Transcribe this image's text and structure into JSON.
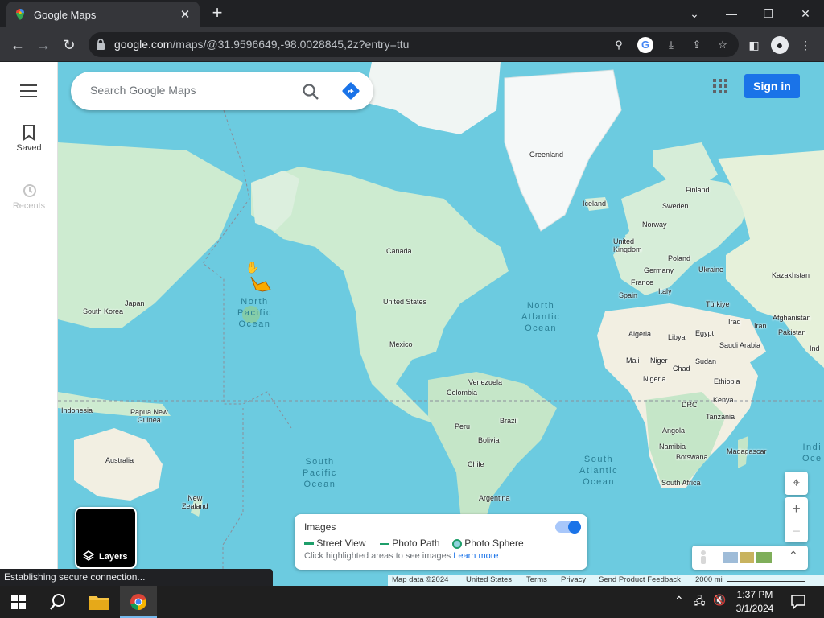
{
  "browser": {
    "tab_title": "Google Maps",
    "url_host": "google.com",
    "url_path": "/maps/@31.9596649,-98.0028845,2z?entry=ttu"
  },
  "rail": {
    "saved_label": "Saved",
    "recents_label": "Recents"
  },
  "search": {
    "placeholder": "Search Google Maps"
  },
  "header": {
    "signin_label": "Sign in"
  },
  "map_labels": {
    "greenland": "Greenland",
    "iceland": "Iceland",
    "finland": "Finland",
    "sweden": "Sweden",
    "norway": "Norway",
    "united_kingdom": "United\nKingdom",
    "poland": "Poland",
    "ukraine": "Ukraine",
    "germany": "Germany",
    "france": "France",
    "italy": "Italy",
    "spain": "Spain",
    "turkiye": "Türkiye",
    "kazakhstan": "Kazakhstan",
    "iraq": "Iraq",
    "iran": "Iran",
    "afghanistan": "Afghanistan",
    "pakistan": "Pakistan",
    "india": "Ind",
    "algeria": "Algeria",
    "libya": "Libya",
    "egypt": "Egypt",
    "saudi_arabia": "Saudi Arabia",
    "mali": "Mali",
    "niger": "Niger",
    "chad": "Chad",
    "sudan": "Sudan",
    "nigeria": "Nigeria",
    "ethiopia": "Ethiopia",
    "kenya": "Kenya",
    "drc": "DRC",
    "tanzania": "Tanzania",
    "angola": "Angola",
    "namibia": "Namibia",
    "botswana": "Botswana",
    "madagascar": "Madagascar",
    "south_africa": "South Africa",
    "canada": "Canada",
    "united_states": "United States",
    "mexico": "Mexico",
    "venezuela": "Venezuela",
    "colombia": "Colombia",
    "peru": "Peru",
    "brazil": "Brazil",
    "bolivia": "Bolivia",
    "chile": "Chile",
    "argentina": "Argentina",
    "japan": "Japan",
    "south_korea": "South Korea",
    "indonesia": "Indonesia",
    "papua_new_guinea": "Papua New\nGuinea",
    "australia": "Australia",
    "new_zealand": "New\nZealand",
    "north_pacific": "North\nPacific\nOcean",
    "north_atlantic": "North\nAtlantic\nOcean",
    "south_pacific": "South\nPacific\nOcean",
    "south_atlantic": "South\nAtlantic\nOcean",
    "indian_ocean": "Indi\nOce"
  },
  "layers": {
    "label": "Layers"
  },
  "images_panel": {
    "title": "Images",
    "street_view": "Street View",
    "photo_path": "Photo Path",
    "photo_sphere": "Photo Sphere",
    "hint": "Click highlighted areas to see images",
    "learn_more": "Learn more"
  },
  "attribution": {
    "map_data": "Map data ©2024",
    "region": "United States",
    "terms": "Terms",
    "privacy": "Privacy",
    "feedback": "Send Product Feedback",
    "scale": "2000 mi"
  },
  "status_bar": {
    "text": "Establishing secure connection..."
  },
  "taskbar": {
    "time": "1:37 PM",
    "date": "3/1/2024"
  },
  "colors": {
    "water": "#6ccbe0",
    "land": "#cdebd0",
    "ice": "#f5f8f8",
    "accent": "#1a73e8"
  }
}
